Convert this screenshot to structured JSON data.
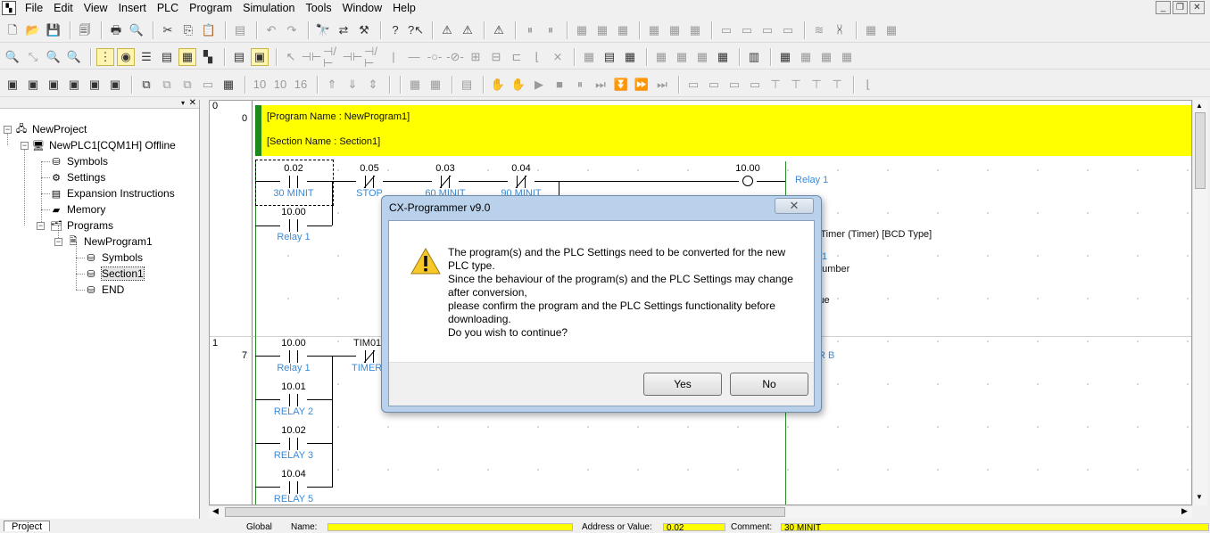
{
  "menubar": {
    "items": [
      "File",
      "Edit",
      "View",
      "Insert",
      "PLC",
      "Program",
      "Simulation",
      "Tools",
      "Window",
      "Help"
    ]
  },
  "tree": {
    "project": "NewProject",
    "plc": "NewPLC1[CQM1H] Offline",
    "symbols": "Symbols",
    "settings": "Settings",
    "expansion": "Expansion Instructions",
    "memory": "Memory",
    "programs": "Programs",
    "program1": "NewProgram1",
    "prog_symbols": "Symbols",
    "section1": "Section1",
    "end": "END",
    "tab": "Project"
  },
  "ladder": {
    "gutter": {
      "r0_rung": "0",
      "r0_step": "0",
      "r1_rung": "1",
      "r1_step": "7"
    },
    "program_name": "[Program Name : NewProgram1]",
    "section_name": "[Section Name : Section1]",
    "rung0": {
      "c1_addr": "0.02",
      "c1_cmt": "30 MINIT",
      "c2_addr": "0.05",
      "c2_cmt": "STOP",
      "c3_addr": "0.03",
      "c3_cmt": "60 MINIT",
      "c4_addr": "0.04",
      "c4_cmt": "90 MINIT",
      "coil_addr": "10.00",
      "coil_cmt": "Relay 1",
      "p1_addr": "10.00",
      "p1_cmt": "Relay 1",
      "right1": "s Timer (Timer) [BCD Type]",
      "right2": "1",
      "right3": "number",
      "right4": "lue"
    },
    "rung1": {
      "c1_addr": "10.00",
      "c1_cmt": "Relay 1",
      "c2_addr": "TIM010",
      "c2_cmt": "TIMER",
      "b1_addr": "10.01",
      "b1_cmt": "RELAY 2",
      "b2_addr": "10.02",
      "b2_cmt": "RELAY 3",
      "b3_addr": "10.04",
      "b3_cmt": "RELAY 5",
      "right1": "R B"
    }
  },
  "status": {
    "global": "Global",
    "name": "Name:",
    "address_value": "Address or Value:",
    "address": "0.02",
    "comment_label": "Comment:",
    "comment": "30 MINIT"
  },
  "dialog": {
    "title": "CX-Programmer v9.0",
    "close": "✕",
    "lines": [
      "The program(s) and the PLC Settings need to be converted for the new PLC type.",
      "Since the behaviour of the program(s) and the PLC Settings may change after conversion,",
      "please confirm the program and the PLC Settings functionality before downloading.",
      "Do you wish to continue?"
    ],
    "yes": "Yes",
    "no": "No"
  }
}
